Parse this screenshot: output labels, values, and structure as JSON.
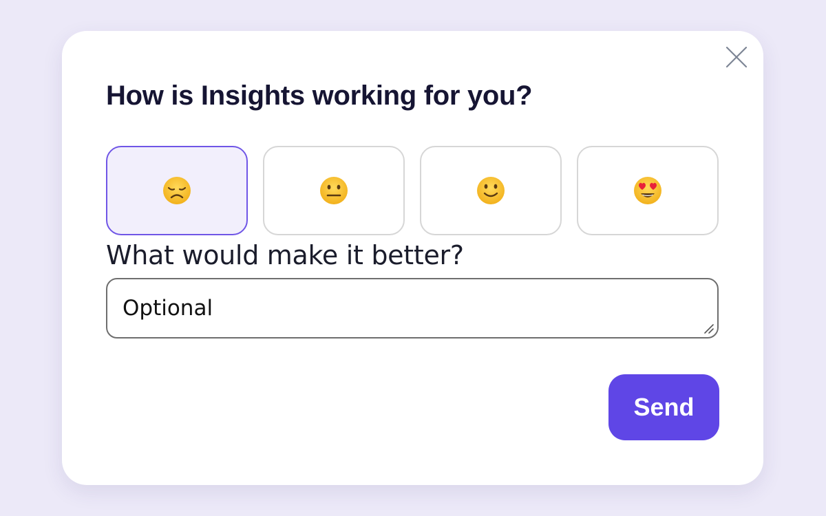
{
  "dialog": {
    "title": "How is Insights working for you?",
    "close_icon": "close-icon"
  },
  "ratings": [
    {
      "icon": "disappointed-face-icon",
      "selected": true
    },
    {
      "icon": "neutral-face-icon",
      "selected": false
    },
    {
      "icon": "slightly-smiling-face-icon",
      "selected": false
    },
    {
      "icon": "heart-eyes-face-icon",
      "selected": false
    }
  ],
  "feedback": {
    "label": "What would make it better?",
    "value": "",
    "placeholder": "Optional"
  },
  "actions": {
    "send_label": "Send"
  },
  "colors": {
    "page_background": "#ECE9F8",
    "card_background": "#FFFFFF",
    "accent": "#5F46E6",
    "selected_border": "#6F55E6",
    "selected_fill": "#F2EFFC",
    "title_text": "#161533"
  }
}
